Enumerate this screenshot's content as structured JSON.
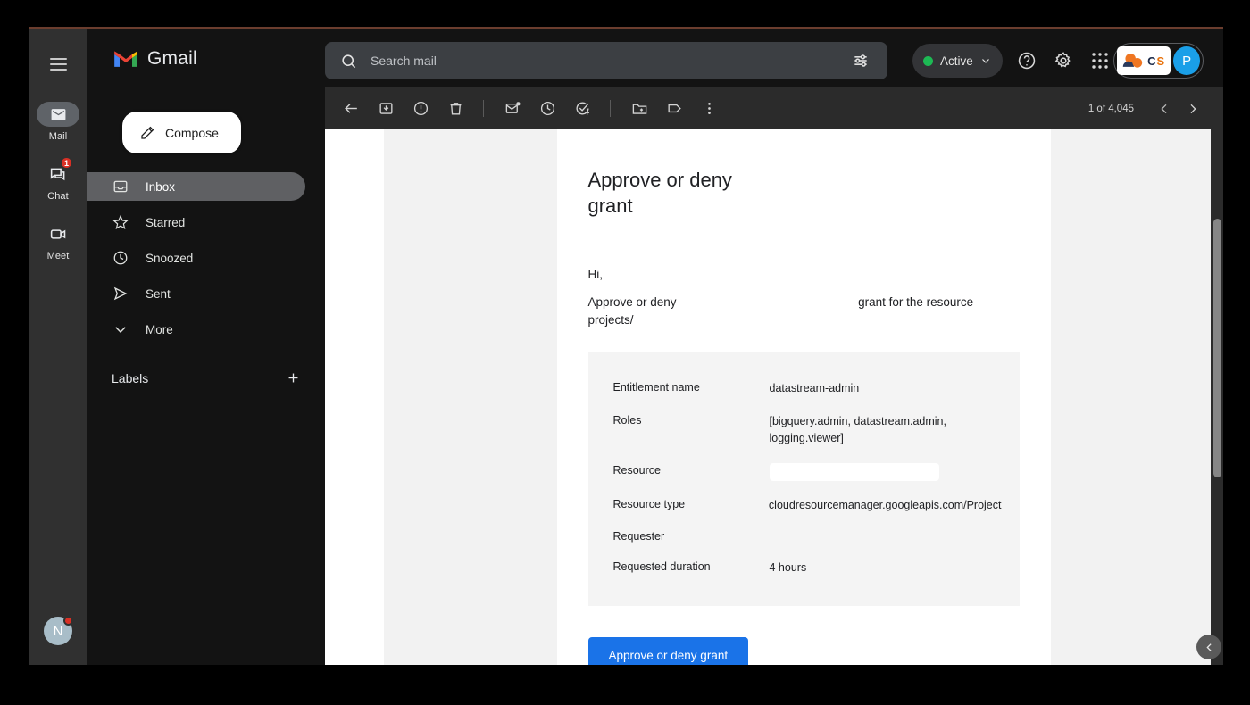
{
  "window": {
    "accent_color": "#6b3d2e"
  },
  "rail": {
    "hamburger": "menu-icon",
    "items": [
      {
        "label": "Mail",
        "icon": "mail-icon",
        "active": true,
        "badge": ""
      },
      {
        "label": "Chat",
        "icon": "chat-icon",
        "active": false,
        "badge": "1"
      },
      {
        "label": "Meet",
        "icon": "meet-icon",
        "active": false,
        "badge": ""
      }
    ],
    "avatar_initial": "N"
  },
  "header": {
    "brand": "Gmail",
    "search": {
      "placeholder": "Search mail",
      "value": "",
      "icon": "search-icon",
      "options_icon": "search-options-icon"
    },
    "status": {
      "label": "Active",
      "dot_color": "#1db954",
      "chevron": "chevron-down-icon"
    },
    "help_icon": "help-icon",
    "settings_icon": "gear-icon",
    "apps_icon": "apps-grid-icon",
    "brand_badge": {
      "text_c": "C",
      "text_s": "S"
    },
    "user_avatar_initial": "P"
  },
  "sidebar": {
    "compose_label": "Compose",
    "compose_icon": "pencil-icon",
    "items": [
      {
        "label": "Inbox",
        "icon": "inbox-icon",
        "active": true
      },
      {
        "label": "Starred",
        "icon": "star-icon",
        "active": false
      },
      {
        "label": "Snoozed",
        "icon": "clock-icon",
        "active": false
      },
      {
        "label": "Sent",
        "icon": "send-icon",
        "active": false
      },
      {
        "label": "More",
        "icon": "chevron-down-icon",
        "active": false
      }
    ],
    "labels_title": "Labels",
    "labels_add_icon": "plus-icon"
  },
  "toolbar": {
    "back_icon": "arrow-back-icon",
    "buttons": [
      {
        "name": "archive-icon"
      },
      {
        "name": "report-spam-icon"
      },
      {
        "name": "delete-icon"
      },
      {
        "name": "mark-unread-icon"
      },
      {
        "name": "snooze-icon"
      },
      {
        "name": "add-to-tasks-icon"
      },
      {
        "name": "move-to-icon"
      },
      {
        "name": "labels-icon"
      },
      {
        "name": "more-options-icon"
      }
    ],
    "pager_count": "1 of 4,045",
    "prev_icon": "chevron-left-icon",
    "next_icon": "chevron-right-icon"
  },
  "email": {
    "title": "Approve or deny grant",
    "greeting": "Hi,",
    "intro_part1": "Approve or deny",
    "intro_part2": "grant for the resource projects/",
    "details": [
      {
        "key": "Entitlement name",
        "value": "datastream-admin",
        "redacted": "none"
      },
      {
        "key": "Roles",
        "value": "[bigquery.admin, datastream.admin, logging.viewer]",
        "redacted": "none"
      },
      {
        "key": "Resource",
        "value": "",
        "redacted": "box"
      },
      {
        "key": "Resource type",
        "value": "cloudresourcemanager.googleapis.com/Project",
        "redacted": "none"
      },
      {
        "key": "Requester",
        "value": "",
        "redacted": "faint"
      },
      {
        "key": "Requested duration",
        "value": "4 hours",
        "redacted": "none"
      }
    ],
    "cta_label": "Approve or deny grant",
    "cta_color": "#1a73e8"
  },
  "scrollbar": {
    "thumb": "scroll-thumb"
  },
  "collapse": {
    "icon": "chevron-left-icon"
  }
}
